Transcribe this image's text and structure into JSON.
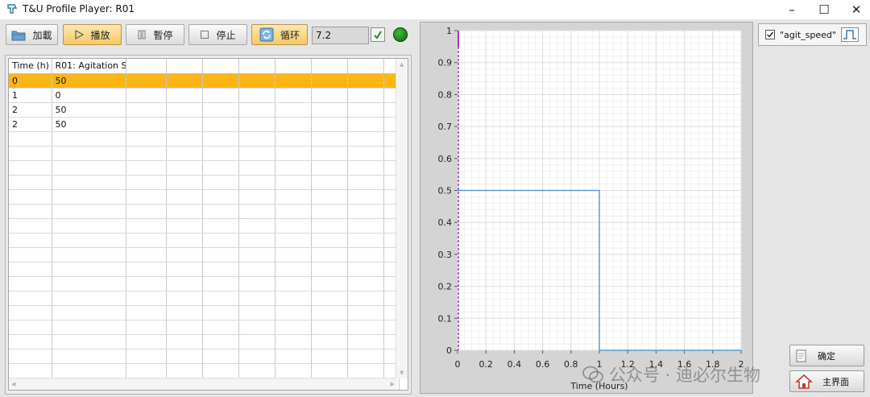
{
  "window": {
    "title": "T&U Profile Player: R01"
  },
  "toolbar": {
    "load_label": "加載",
    "play_label": "播放",
    "pause_label": "暫停",
    "stop_label": "停止",
    "loop_label": "循环",
    "value": "7.2"
  },
  "table": {
    "headers": [
      "Time (h)",
      "R01: Agitation Sp"
    ],
    "rows": [
      [
        "0",
        "50"
      ],
      [
        "1",
        "0"
      ],
      [
        "2",
        "50"
      ],
      [
        "2",
        "50"
      ]
    ],
    "selected_row": 0
  },
  "legend": {
    "label": "\"agit_speed\""
  },
  "buttons": {
    "confirm_label": "确定",
    "home_label": "主界面"
  },
  "watermark": {
    "text": "公众号 · 迪必尔生物"
  },
  "colors": {
    "selected_row": "#fcb514",
    "series": "#5b9bd5",
    "cursor": "#9b3dab",
    "led": "#0f8a0f"
  },
  "chart_data": {
    "type": "line",
    "step": true,
    "xlabel": "Time (Hours)",
    "ylabel": "",
    "xlim": [
      0,
      2
    ],
    "ylim": [
      0,
      1
    ],
    "x_ticks": [
      "0",
      "0.2",
      "0.4",
      "0.6",
      "0.8",
      "1",
      "1.2",
      "1.4",
      "1.6",
      "1.8",
      "2"
    ],
    "y_ticks": [
      "0",
      "0.1",
      "0.2",
      "0.3",
      "0.4",
      "0.5",
      "0.6",
      "0.7",
      "0.8",
      "0.9",
      "1"
    ],
    "grid": true,
    "series": [
      {
        "x": [
          0,
          1,
          1,
          2
        ],
        "y": [
          0.5,
          0.5,
          0,
          0
        ]
      }
    ],
    "cursor_x": 0
  }
}
